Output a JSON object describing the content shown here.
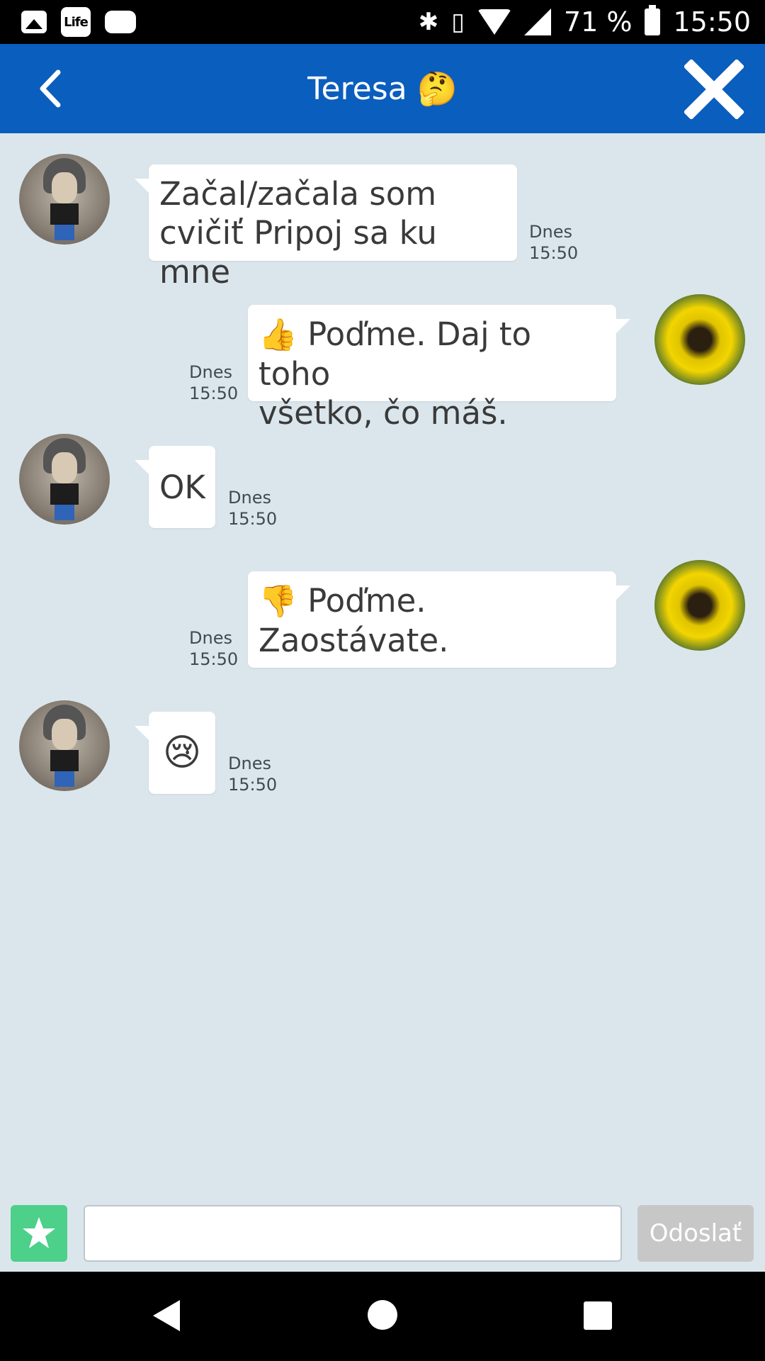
{
  "status_bar": {
    "carrier_app_label": "Life",
    "battery_percent": "71 %",
    "time": "15:50",
    "icons": [
      "gallery-icon",
      "life-app-icon",
      "chat-icon",
      "bluetooth-icon",
      "vibrate-icon",
      "wifi-icon",
      "signal-icon",
      "battery-icon"
    ]
  },
  "header": {
    "title": "Teresa",
    "title_emoji": "🤔",
    "accent_color": "#0a5ebd"
  },
  "messages": [
    {
      "direction": "in",
      "text": "Začal/začala som cvičiť Pripoj sa ku mne",
      "line1": "Začal/začala som",
      "line2": "cvičiť Pripoj sa ku mne",
      "date": "Dnes",
      "time": "15:50"
    },
    {
      "direction": "out",
      "emoji": "👍",
      "line1": "Poďme. Daj to toho",
      "line2": "všetko, čo máš.",
      "date": "Dnes",
      "time": "15:50"
    },
    {
      "direction": "in",
      "text": "OK",
      "date": "Dnes",
      "time": "15:50"
    },
    {
      "direction": "out",
      "emoji": "👎",
      "line1": "Poďme.",
      "line2": "Zaostávate.",
      "date": "Dnes",
      "time": "15:50"
    },
    {
      "direction": "in",
      "emoji": "😢",
      "date": "Dnes",
      "time": "15:50"
    }
  ],
  "composer": {
    "input_value": "",
    "send_label": "Odoslať",
    "star_color": "#4cd08a"
  }
}
